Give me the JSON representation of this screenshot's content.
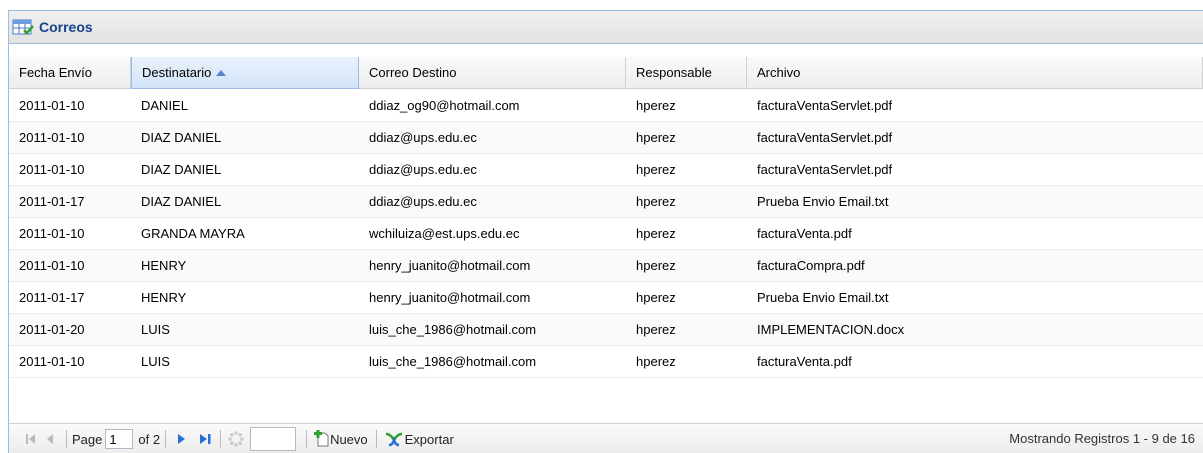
{
  "panel": {
    "title": "Correos"
  },
  "columns": [
    "Fecha Envío",
    "Destinatario",
    "Correo Destino",
    "Responsable",
    "Archivo"
  ],
  "rows": [
    [
      "2011-01-10",
      "DANIEL",
      "ddiaz_og90@hotmail.com",
      "hperez",
      "facturaVentaServlet.pdf"
    ],
    [
      "2011-01-10",
      "DIAZ DANIEL",
      "ddiaz@ups.edu.ec",
      "hperez",
      "facturaVentaServlet.pdf"
    ],
    [
      "2011-01-10",
      "DIAZ DANIEL",
      "ddiaz@ups.edu.ec",
      "hperez",
      "facturaVentaServlet.pdf"
    ],
    [
      "2011-01-17",
      "DIAZ DANIEL",
      "ddiaz@ups.edu.ec",
      "hperez",
      "Prueba Envio Email.txt"
    ],
    [
      "2011-01-10",
      "GRANDA MAYRA",
      "wchiluiza@est.ups.edu.ec",
      "hperez",
      "facturaVenta.pdf"
    ],
    [
      "2011-01-10",
      "HENRY",
      "henry_juanito@hotmail.com",
      "hperez",
      "facturaCompra.pdf"
    ],
    [
      "2011-01-17",
      "HENRY",
      "henry_juanito@hotmail.com",
      "hperez",
      "Prueba Envio Email.txt"
    ],
    [
      "2011-01-20",
      "LUIS",
      "luis_che_1986@hotmail.com",
      "hperez",
      "IMPLEMENTACION.docx"
    ],
    [
      "2011-01-10",
      "LUIS",
      "luis_che_1986@hotmail.com",
      "hperez",
      "facturaVenta.pdf"
    ]
  ],
  "pager": {
    "page_label": "Page",
    "page_value": "1",
    "of_label": "of 2",
    "nuevo_label": "Nuevo",
    "exportar_label": "Exportar",
    "status": "Mostrando Registros 1 - 9 de 16"
  },
  "icons": {
    "title": "grid-table-icon",
    "first": "first-page-icon",
    "prev": "prev-page-icon",
    "next": "next-page-icon",
    "last": "last-page-icon",
    "refresh": "refresh-icon",
    "nuevo": "add-document-icon",
    "exportar": "export-icon"
  },
  "colors": {
    "header_text": "#15428b",
    "border": "#99bbe8",
    "nav_blue": "#2a6fd6"
  }
}
